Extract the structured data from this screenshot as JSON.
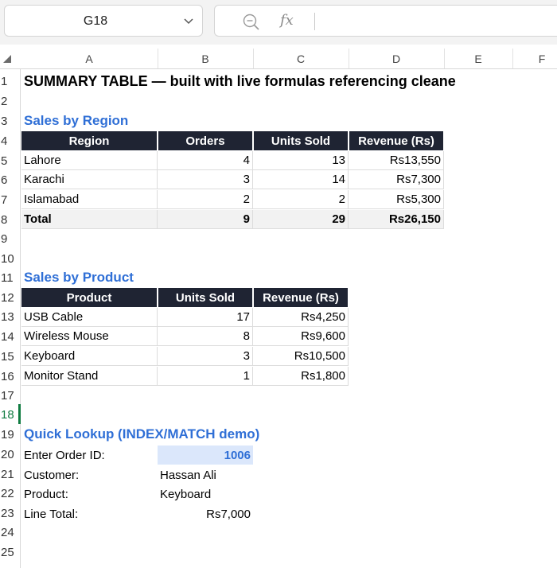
{
  "formula_bar": {
    "name_box": "G18",
    "fx_label": "fx",
    "formula": ""
  },
  "columns": [
    "A",
    "B",
    "C",
    "D",
    "E",
    "F"
  ],
  "rows": [
    "1",
    "2",
    "3",
    "4",
    "5",
    "6",
    "7",
    "8",
    "9",
    "10",
    "11",
    "12",
    "13",
    "14",
    "15",
    "16",
    "17",
    "18",
    "19",
    "20",
    "21",
    "22",
    "23",
    "24",
    "25"
  ],
  "active_row": "18",
  "title": "SUMMARY TABLE — built with live formulas referencing cleane",
  "region_section": {
    "heading": "Sales by Region",
    "headers": [
      "Region",
      "Orders",
      "Units Sold",
      "Revenue (Rs)"
    ],
    "rows": [
      [
        "Lahore",
        "4",
        "13",
        "Rs13,550"
      ],
      [
        "Karachi",
        "3",
        "14",
        "Rs7,300"
      ],
      [
        "Islamabad",
        "2",
        "2",
        "Rs5,300"
      ]
    ],
    "total": [
      "Total",
      "9",
      "29",
      "Rs26,150"
    ]
  },
  "product_section": {
    "heading": "Sales by Product",
    "headers": [
      "Product",
      "Units Sold",
      "Revenue (Rs)"
    ],
    "rows": [
      [
        "USB Cable",
        "17",
        "Rs4,250"
      ],
      [
        "Wireless Mouse",
        "8",
        "Rs9,600"
      ],
      [
        "Keyboard",
        "3",
        "Rs10,500"
      ],
      [
        "Monitor Stand",
        "1",
        "Rs1,800"
      ]
    ]
  },
  "lookup": {
    "heading": "Quick Lookup (INDEX/MATCH demo)",
    "order_label": "Enter Order ID:",
    "order_value": "1006",
    "customer_label": "Customer:",
    "customer_value": "Hassan Ali",
    "product_label": "Product:",
    "product_value": "Keyboard",
    "total_label": "Line Total:",
    "total_value": "Rs7,000"
  }
}
